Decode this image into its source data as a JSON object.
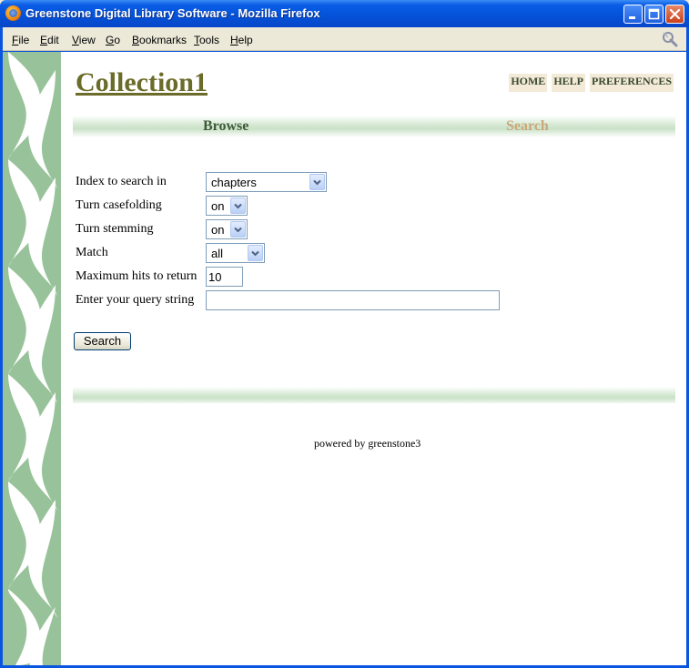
{
  "window": {
    "title": "Greenstone Digital Library Software - Mozilla Firefox",
    "icon": "firefox-icon"
  },
  "menu": [
    {
      "label": "File",
      "accel": "F",
      "rest": "ile"
    },
    {
      "label": "Edit",
      "accel": "E",
      "rest": "dit"
    },
    {
      "label": "View",
      "accel": "V",
      "rest": "iew"
    },
    {
      "label": "Go",
      "accel": "G",
      "rest": "o"
    },
    {
      "label": "Bookmarks",
      "accel": "B",
      "rest": "ookmarks"
    },
    {
      "label": "Tools",
      "accel": "T",
      "rest": "ools"
    },
    {
      "label": "Help",
      "accel": "H",
      "rest": "elp"
    }
  ],
  "page": {
    "collection_title": "Collection1",
    "top_links": {
      "home": "HOME",
      "help": "HELP",
      "preferences": "PREFERENCES"
    },
    "nav": {
      "browse": "Browse",
      "search": "Search"
    },
    "form": {
      "index_label": "Index to search in",
      "index_value": "chapters",
      "casefolding_label": "Turn casefolding",
      "casefolding_value": "on",
      "stemming_label": "Turn stemming",
      "stemming_value": "on",
      "match_label": "Match",
      "match_value": "all",
      "maxhits_label": "Maximum hits to return",
      "maxhits_value": "10",
      "query_label": "Enter your query string",
      "query_value": ""
    },
    "search_button": "Search",
    "powered_by": "powered by greenstone3"
  },
  "colors": {
    "title_olive": "#6b6b2a",
    "nav_browse": "#3d5a38",
    "nav_search": "#c8a878",
    "sidebar_green": "#98c39a"
  }
}
